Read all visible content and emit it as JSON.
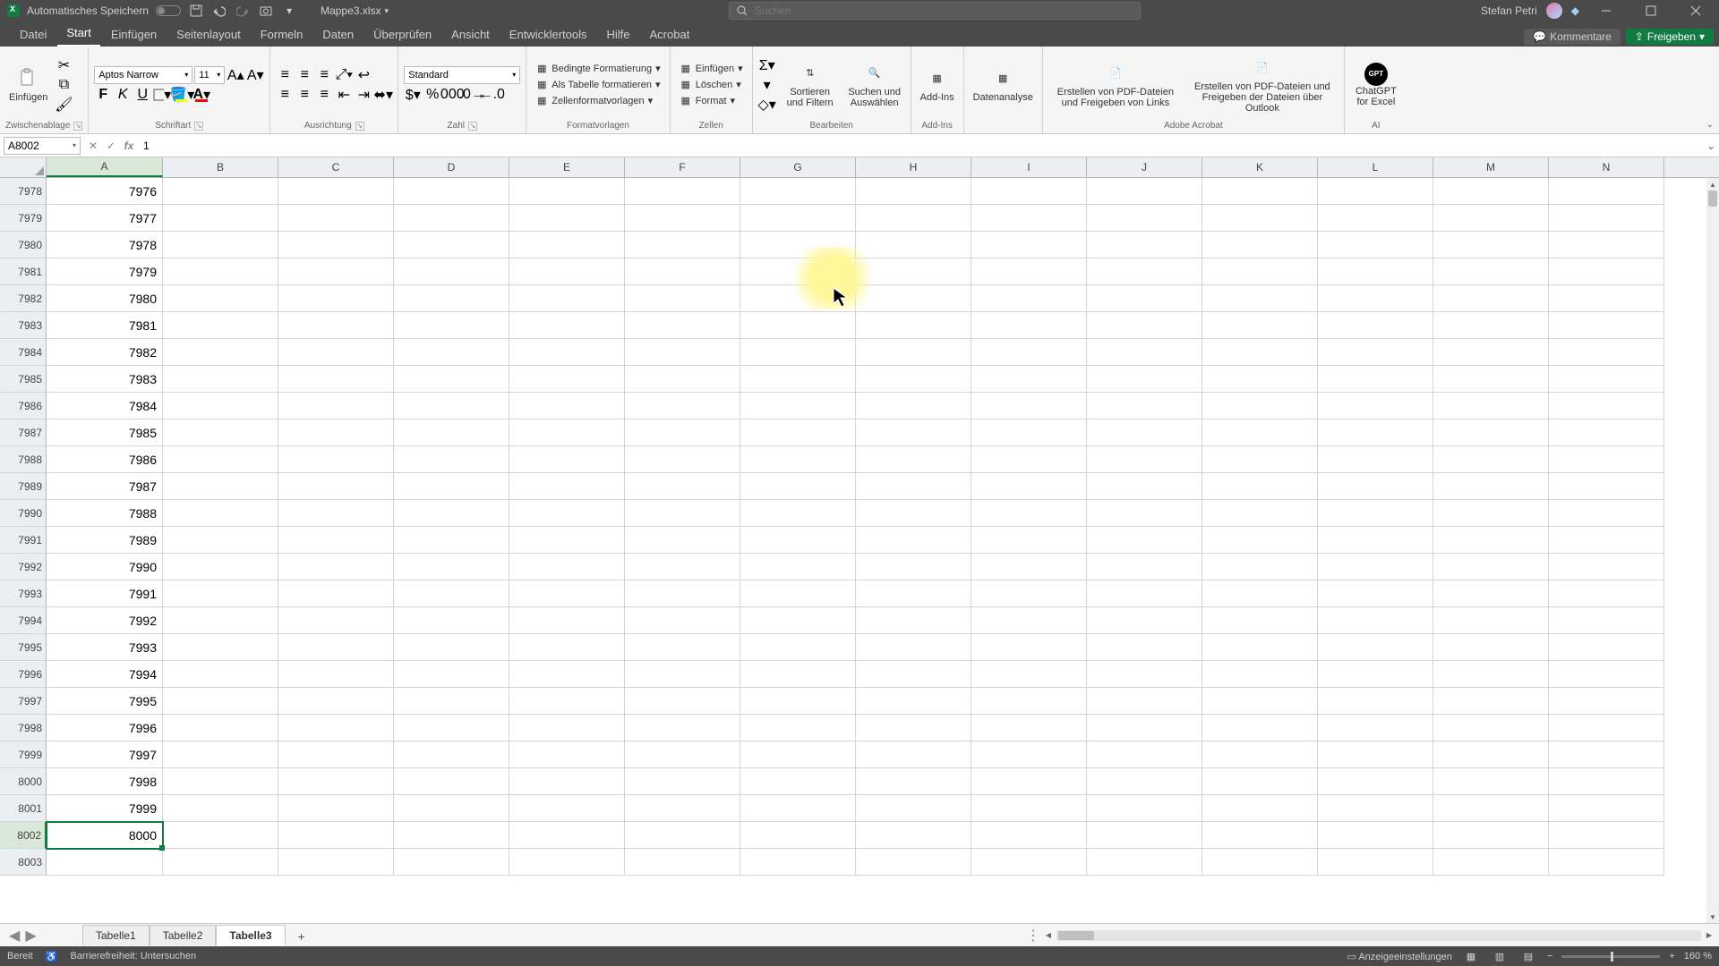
{
  "titlebar": {
    "autosave_label": "Automatisches Speichern",
    "filename": "Mappe3.xlsx",
    "search_placeholder": "Suchen",
    "username": "Stefan Petri"
  },
  "tabs": {
    "items": [
      "Datei",
      "Start",
      "Einfügen",
      "Seitenlayout",
      "Formeln",
      "Daten",
      "Überprüfen",
      "Ansicht",
      "Entwicklertools",
      "Hilfe",
      "Acrobat"
    ],
    "active_index": 1,
    "comments": "Kommentare",
    "share": "Freigeben"
  },
  "ribbon": {
    "clipboard": {
      "paste": "Einfügen",
      "label": "Zwischenablage"
    },
    "font": {
      "name": "Aptos Narrow",
      "size": "11",
      "bold": "F",
      "italic": "K",
      "underline": "U",
      "label": "Schriftart"
    },
    "align": {
      "label": "Ausrichtung"
    },
    "number": {
      "format": "Standard",
      "label": "Zahl"
    },
    "styles": {
      "cond": "Bedingte Formatierung",
      "table": "Als Tabelle formatieren",
      "cell": "Zellenformatvorlagen",
      "label": "Formatvorlagen"
    },
    "cells": {
      "insert": "Einfügen",
      "delete": "Löschen",
      "format": "Format",
      "label": "Zellen"
    },
    "editing": {
      "sort": "Sortieren und Filtern",
      "find": "Suchen und Auswählen",
      "label": "Bearbeiten"
    },
    "addins": {
      "btn": "Add-Ins",
      "label": "Add-Ins"
    },
    "analysis": {
      "btn": "Datenanalyse"
    },
    "acrobat": {
      "links": "Erstellen von PDF-Dateien und Freigeben von Links",
      "outlook": "Erstellen von PDF-Dateien und Freigeben der Dateien über Outlook",
      "label": "Adobe Acrobat"
    },
    "ai": {
      "btn": "ChatGPT for Excel",
      "label": "AI"
    }
  },
  "formula_bar": {
    "cell_ref": "A8002",
    "value": "1"
  },
  "grid": {
    "columns": [
      "A",
      "B",
      "C",
      "D",
      "E",
      "F",
      "G",
      "H",
      "I",
      "J",
      "K",
      "L",
      "M",
      "N"
    ],
    "first_row": 7978,
    "values_a": [
      7976,
      7977,
      7978,
      7979,
      7980,
      7981,
      7982,
      7983,
      7984,
      7985,
      7986,
      7987,
      7988,
      7989,
      7990,
      7991,
      7992,
      7993,
      7994,
      7995,
      7996,
      7997,
      7998,
      7999,
      8000
    ],
    "active_row": 8002,
    "empty_row": 8003
  },
  "sheets": {
    "tabs": [
      "Tabelle1",
      "Tabelle2",
      "Tabelle3"
    ],
    "active_index": 2
  },
  "statusbar": {
    "ready": "Bereit",
    "accessibility": "Barrierefreiheit: Untersuchen",
    "display": "Anzeigeeinstellungen",
    "zoom": "160 %"
  }
}
